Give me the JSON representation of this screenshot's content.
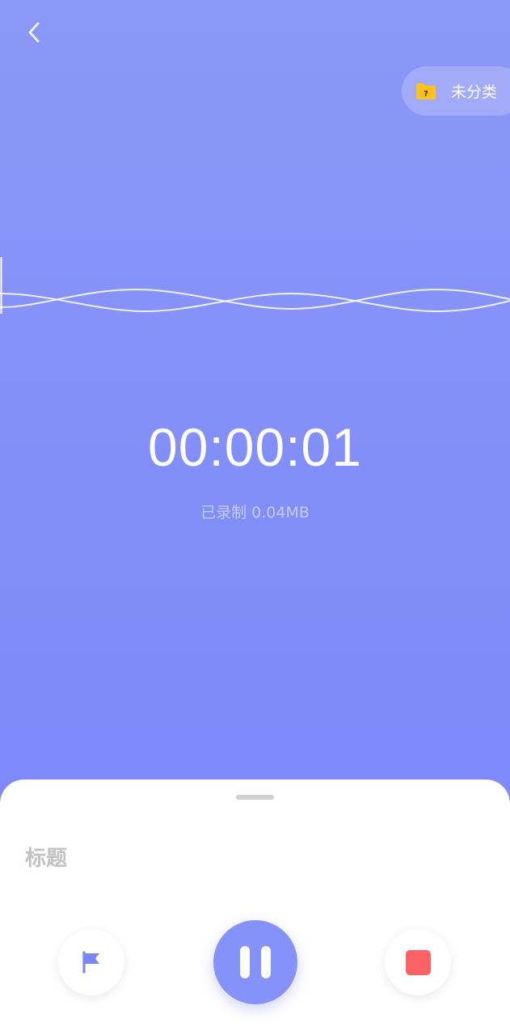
{
  "header": {
    "back_icon": "chevron-left-icon",
    "category": {
      "icon": "folder-unknown-icon",
      "label": "未分类",
      "icon_color": "#ffc21a"
    }
  },
  "recording": {
    "elapsed": "00:00:01",
    "size_text": "已录制 0.04MB"
  },
  "sheet": {
    "title_placeholder": "标题",
    "title_value": ""
  },
  "controls": {
    "flag_icon": "flag-icon",
    "pause_icon": "pause-icon",
    "stop_icon": "stop-icon"
  },
  "colors": {
    "background_top": "#8c98f7",
    "background_bottom": "#7a84fb",
    "accent": "#8492f9",
    "stop": "#ff6265",
    "flag": "#7b86f2"
  }
}
